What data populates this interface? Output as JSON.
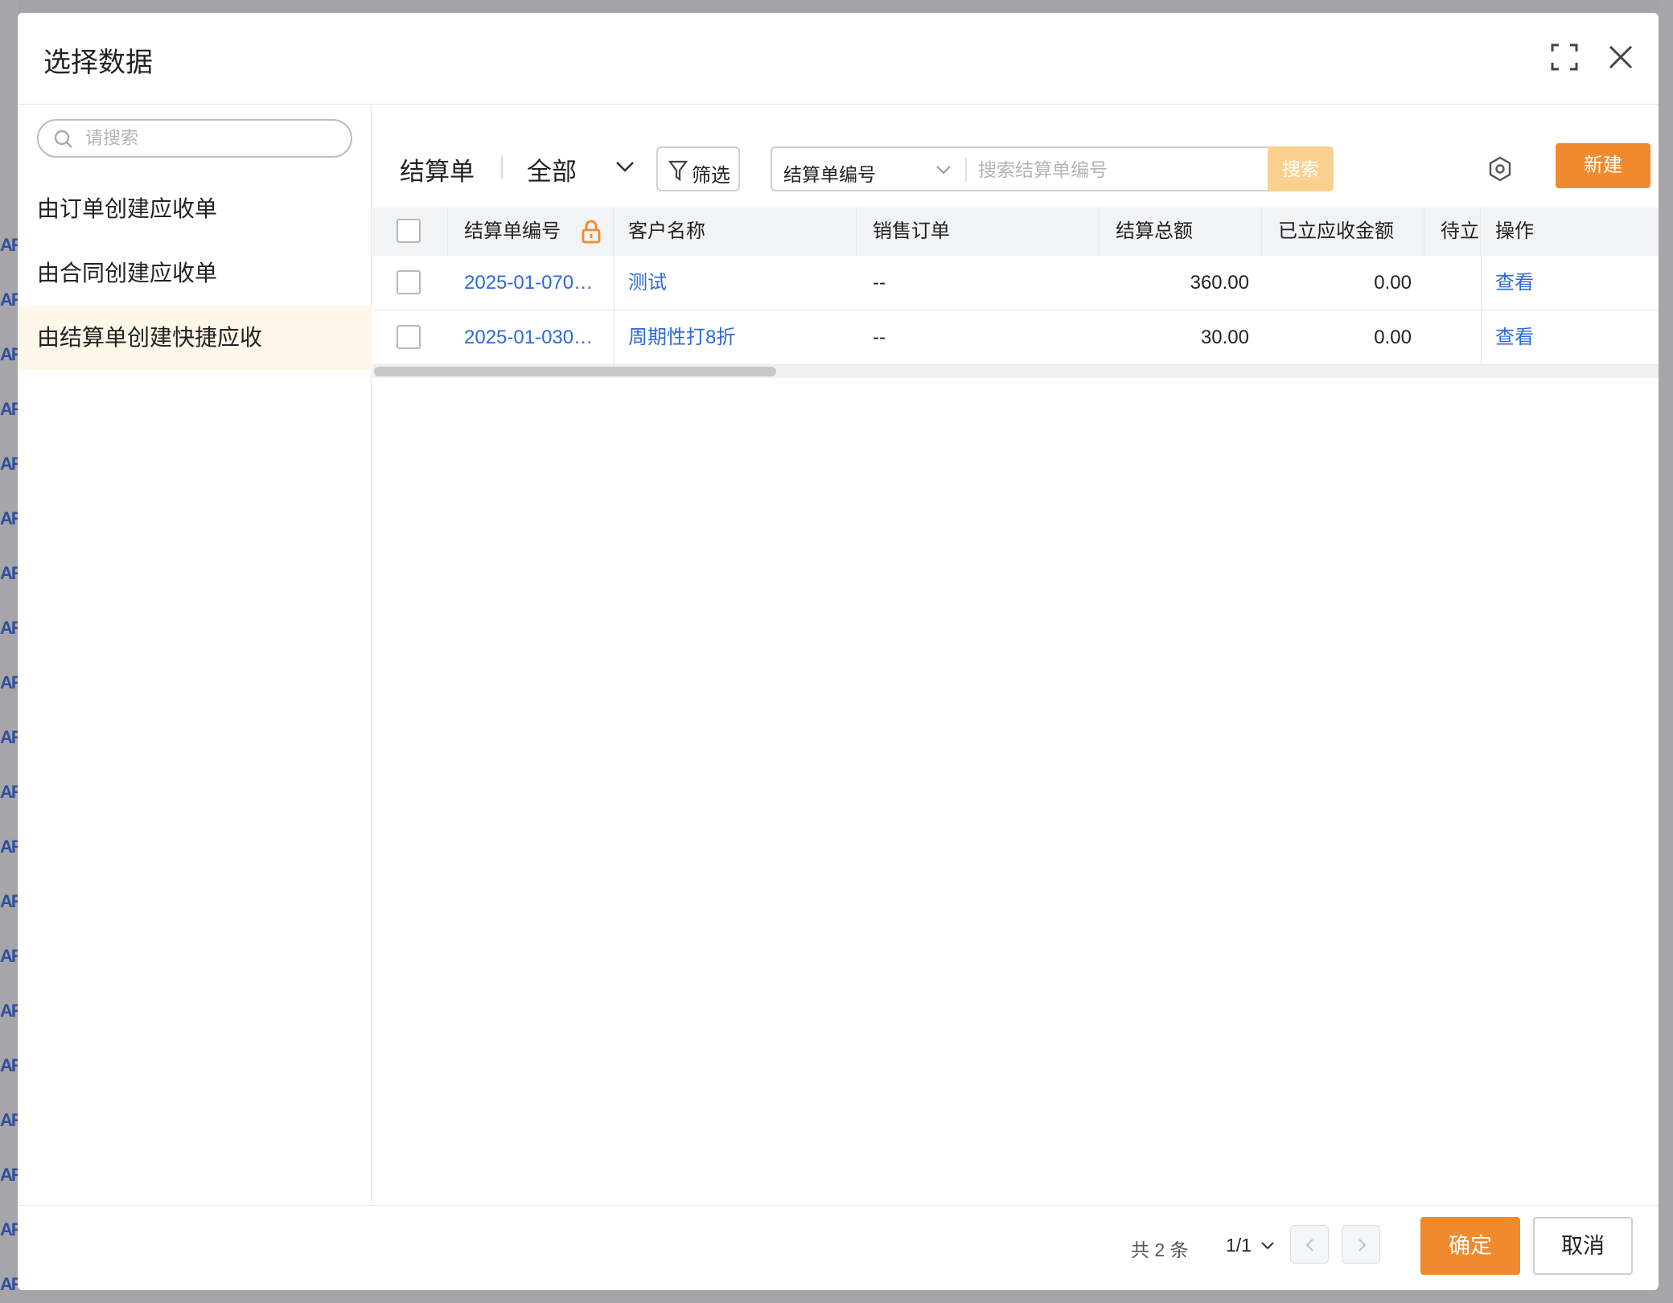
{
  "background": {
    "peek_rows": [
      "AR",
      "AR",
      "AR",
      "AR",
      "AR",
      "AR",
      "AR",
      "AR",
      "AR",
      "AR",
      "AR",
      "AR",
      "AR",
      "AR",
      "AR",
      "AR",
      "AR",
      "AR",
      "AR",
      "AR"
    ]
  },
  "modal": {
    "title": "选择数据"
  },
  "sidebar": {
    "search_placeholder": "请搜索",
    "items": [
      {
        "label": "由订单创建应收单"
      },
      {
        "label": "由合同创建应收单"
      },
      {
        "label": "由结算单创建快捷应收"
      }
    ]
  },
  "toolbar": {
    "title": "结算单",
    "scope": "全部",
    "filter_label": "筛选",
    "search_field": "结算单编号",
    "search_placeholder": "搜索结算单编号",
    "search_button": "搜索",
    "new_button": "新建"
  },
  "table": {
    "headers": {
      "code": "结算单编号",
      "customer": "客户名称",
      "sales_order": "销售订单",
      "total": "结算总额",
      "received": "已立应收金额",
      "pending": "待立",
      "action": "操作"
    },
    "rows": [
      {
        "code": "2025-01-070…",
        "customer": "测试",
        "sales_order": "--",
        "total": "360.00",
        "received": "0.00",
        "action": "查看"
      },
      {
        "code": "2025-01-030…",
        "customer": "周期性打8折",
        "sales_order": "--",
        "total": "30.00",
        "received": "0.00",
        "action": "查看"
      }
    ]
  },
  "footer": {
    "total_text": "共 2 条",
    "page": "1/1",
    "confirm": "确定",
    "cancel": "取消"
  },
  "colors": {
    "accent": "#f08a2e",
    "link": "#2d6ad6",
    "search_button": "#fbd190",
    "active_item_bg": "#fff7ea"
  }
}
